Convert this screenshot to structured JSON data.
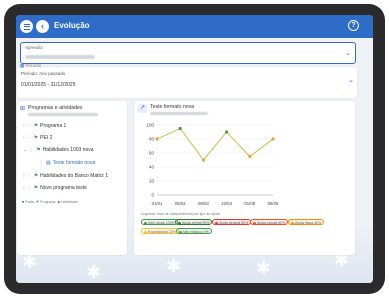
{
  "header": {
    "title": "Evolução"
  },
  "student_select": {
    "label": "Aprendiz"
  },
  "period": {
    "section_label": "Período",
    "field_label": "Período: Ano passado",
    "range": "01/01/2025 - 31/12/2025"
  },
  "programs": {
    "title": "Programas e atividades",
    "items": [
      {
        "label": "Programa 1"
      },
      {
        "label": "PEI 2"
      },
      {
        "label": "Habilidades 1003 nova"
      },
      {
        "label": "Teste formato nova"
      },
      {
        "label": "Habilidades do Banco Matriz 1"
      },
      {
        "label": "Novo programa teste"
      }
    ],
    "footer": [
      "Pasta",
      "Programa",
      "Habilidade"
    ]
  },
  "chart_card": {
    "title": "Teste formato nova"
  },
  "chart_data": {
    "type": "line",
    "categories": [
      "01/01",
      "05/02",
      "08/03",
      "22/04",
      "01/09",
      "06/09"
    ],
    "values": [
      80,
      95,
      50,
      90,
      55,
      80
    ],
    "ylim": [
      0,
      100
    ],
    "yticks": [
      0,
      20,
      40,
      60,
      80,
      100
    ],
    "line_color": "#c4b52a",
    "point_colors": [
      "#e6a23c",
      "#3f9b4b",
      "#e6a23c",
      "#3f9b4b",
      "#e6a23c",
      "#e6a23c"
    ]
  },
  "legend": {
    "title": "Legenda: nível de independência por tipo de ajuda",
    "chips": [
      {
        "label": "Sem ajuda 100%",
        "color": "#3f9b4b"
      },
      {
        "label": "Ajuda verbal 95%",
        "color": "#2e7d32"
      },
      {
        "label": "Ajuda gestual 80%",
        "color": "#e53935"
      },
      {
        "label": "Ajuda parcial 60%",
        "color": "#f4511e"
      },
      {
        "label": "Ajuda física 40%",
        "color": "#fb8c00"
      },
      {
        "label": "Exposicional 22%",
        "color": "#fbc02d"
      },
      {
        "label": "Não realizou 0%",
        "color": "#43a047"
      }
    ]
  }
}
